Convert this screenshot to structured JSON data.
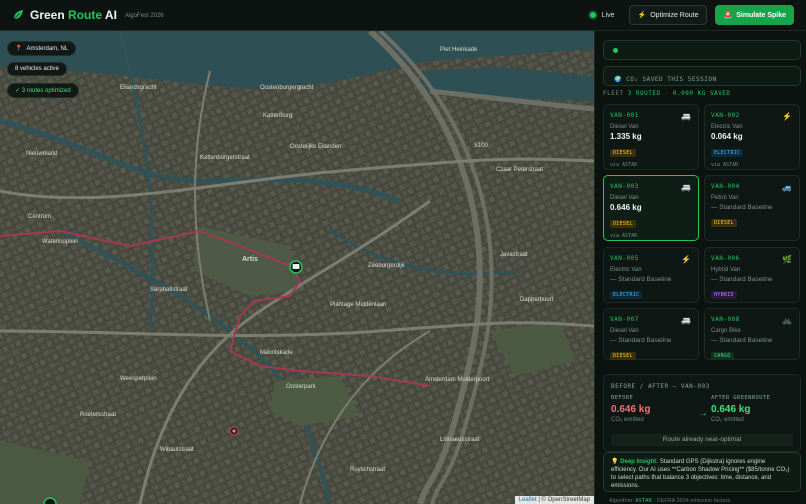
{
  "header": {
    "brand_green": "Green",
    "brand_route": "Route",
    "brand_ai": "AI",
    "tag": "AlgoFest 2026",
    "live": "Live",
    "optimize_icon": "⚡",
    "optimize": "Optimize Route",
    "spike_icon": "🚨",
    "spike": "Simulate Spike"
  },
  "map": {
    "chip_location_icon": "📍",
    "chip_location": "Amsterdam, NL",
    "chip_vehicles": "8 vehicles active",
    "chip_optimized": "✓ 3 routes optimized",
    "attr_leaflet": "Leaflet",
    "attr_osm": "| © OpenStreetMap",
    "labels": {
      "kattenburg": "Kattenburg",
      "oostelijke": "Oostelijke Eilanden",
      "kattenburgerstraat": "Kattenburgerstraat",
      "nieuwmarkt": "Nieuwmarkt",
      "waterlooplein": "Waterlooplein",
      "artis": "Artis",
      "zeeburgerdijk": "Zeeburgerdijk",
      "s100": "S100",
      "mauritskade": "Mauritskade",
      "weesperplein": "Weesperplein",
      "oosterpark": "Oosterpark",
      "amstel_station": "Amsterdam Muiderpoort",
      "sarphatistraat": "Sarphatistraat",
      "wibautstraat": "Wibautstraat",
      "overtoom": "Roetersstraat",
      "ij_boulevard": "Piet Heinkade",
      "marketplace": "Czaar Peterstraat",
      "javastraat": "Javastraat",
      "centrum": "Centrum",
      "dapperbuurt": "Dapperbuurt",
      "linnaeus": "Linnaeusstraat",
      "oostenburg": "Oostenburgergracht",
      "eilandsteiger": "Eilandsgracht",
      "ruyschstraat": "Ruyschstraat",
      "plantage": "Plantage Middenlaan"
    }
  },
  "panel": {
    "co2_label": "🌍 CO₂ SAVED THIS SESSION",
    "fleet_prefix": "FLEET",
    "fleet_value": "3 ROUTED · 0.000 KG SAVED",
    "vehicles": [
      {
        "id": "VAN-001",
        "icon": "🚐",
        "type": "Diesel Van",
        "value": "1.335 kg",
        "badge": "DIESEL",
        "via": "via ASTAR"
      },
      {
        "id": "VAN-002",
        "icon": "⚡",
        "type": "Electric Van",
        "value": "0.064 kg",
        "badge": "ELECTRIC",
        "via": "via ASTAR"
      },
      {
        "id": "VAN-003",
        "icon": "🚐",
        "type": "Diesel Van",
        "value": "0.646 kg",
        "badge": "DIESEL",
        "via": "via ASTAR"
      },
      {
        "id": "VAN-004",
        "icon": "🚙",
        "type": "Petrol Van",
        "value": "— Standard Baseline",
        "badge": "DIESEL",
        "via": ""
      },
      {
        "id": "VAN-005",
        "icon": "⚡",
        "type": "Electric Van",
        "value": "— Standard Baseline",
        "badge": "ELECTRIC",
        "via": ""
      },
      {
        "id": "VAN-006",
        "icon": "🌿",
        "type": "Hybrid Van",
        "value": "— Standard Baseline",
        "badge": "HYBRID",
        "via": ""
      },
      {
        "id": "VAN-007",
        "icon": "🚐",
        "type": "Diesel Van",
        "value": "— Standard Baseline",
        "badge": "DIESEL",
        "via": ""
      },
      {
        "id": "VAN-008",
        "icon": "🚲",
        "type": "Cargo Bike",
        "value": "— Standard Baseline",
        "badge": "CARGO",
        "via": ""
      }
    ],
    "ba_title": "BEFORE / AFTER — VAN-003",
    "before_label": "BEFORE",
    "before_value": "0.646 kg",
    "before_sub": "CO₂ emitted",
    "after_label": "AFTER GREENROUTE",
    "after_value": "0.646 kg",
    "after_sub": "CO₂ emitted",
    "ba_note": "Route already near-optimal",
    "insight_icon": "💡",
    "insight_label": "Deep Insight:",
    "insight_text": "Standard GPS (Dijkstra) ignores engine efficiency. Our AI uses **Carbon Shadow Pricing** ($85/tonne CO₂) to select paths that balance 3 objectives: time, distance, and emissions.",
    "footer_prefix": "Algorithm:",
    "footer_algo": "ASTAR",
    "footer_suffix": "· DEFRA 2024 emission factors"
  },
  "colors": {
    "accent": "#22c55e",
    "before": "#f87171",
    "after": "#4ade80"
  }
}
